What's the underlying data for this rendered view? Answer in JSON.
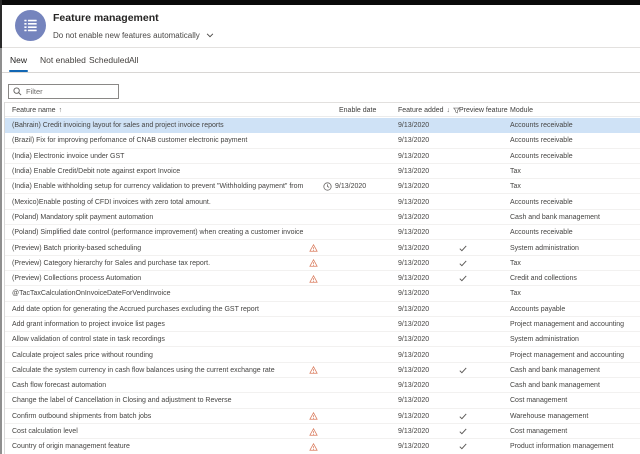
{
  "header": {
    "title": "Feature management",
    "subtitle": "Do not enable new features automatically",
    "icon": "feature-management-workspace-icon"
  },
  "tabs": [
    {
      "label": "New",
      "selected": true
    },
    {
      "label": "Not enabled",
      "selected": false
    },
    {
      "label": "Scheduled",
      "selected": false
    },
    {
      "label": "All",
      "selected": false
    }
  ],
  "filter": {
    "placeholder": "Filter",
    "icon": "search-icon"
  },
  "table": {
    "columns": [
      {
        "label": "Feature name",
        "sort": "asc"
      },
      {
        "label": "Enable date",
        "sort": null
      },
      {
        "label": "Feature added",
        "sort": "desc",
        "filtered": true
      },
      {
        "label": "Preview feature",
        "sort": null
      },
      {
        "label": "Module",
        "sort": null
      }
    ],
    "rows": [
      {
        "name": "(Bahrain) Credit invoicing layout for sales and project invoice reports",
        "warning": false,
        "enable_date": "",
        "feature_added": "9/13/2020",
        "preview": false,
        "module": "Accounts receivable",
        "selected": true
      },
      {
        "name": "(Brazil) Fix for improving perfomance of CNAB customer electronic payment",
        "warning": false,
        "enable_date": "",
        "feature_added": "9/13/2020",
        "preview": false,
        "module": "Accounts receivable",
        "selected": false
      },
      {
        "name": "(India) Electronic invoice under GST",
        "warning": false,
        "enable_date": "",
        "feature_added": "9/13/2020",
        "preview": false,
        "module": "Accounts receivable",
        "selected": false
      },
      {
        "name": "(India) Enable Credit/Debit note against export Invoice",
        "warning": false,
        "enable_date": "",
        "feature_added": "9/13/2020",
        "preview": false,
        "module": "Tax",
        "selected": false
      },
      {
        "name": "(India) Enable withholding setup for currency validation to prevent \"Withholding payment\" from f...",
        "warning": false,
        "enable_date": "9/13/2020",
        "feature_added": "9/13/2020",
        "preview": false,
        "module": "Tax",
        "selected": false
      },
      {
        "name": "(Mexico)Enable posting of CFDI invoices with zero total amount.",
        "warning": false,
        "enable_date": "",
        "feature_added": "9/13/2020",
        "preview": false,
        "module": "Accounts receivable",
        "selected": false
      },
      {
        "name": "(Poland) Mandatory split payment automation",
        "warning": false,
        "enable_date": "",
        "feature_added": "9/13/2020",
        "preview": false,
        "module": "Cash and bank management",
        "selected": false
      },
      {
        "name": "(Poland) Simplified date control (performance improvement) when creating a customer invoice.",
        "warning": false,
        "enable_date": "",
        "feature_added": "9/13/2020",
        "preview": false,
        "module": "Accounts receivable",
        "selected": false
      },
      {
        "name": "(Preview) Batch priority-based scheduling",
        "warning": true,
        "enable_date": "",
        "feature_added": "9/13/2020",
        "preview": true,
        "module": "System administration",
        "selected": false
      },
      {
        "name": "(Preview) Category hierarchy for Sales and purchase tax report.",
        "warning": true,
        "enable_date": "",
        "feature_added": "9/13/2020",
        "preview": true,
        "module": "Tax",
        "selected": false
      },
      {
        "name": "(Preview) Collections process Automation",
        "warning": true,
        "enable_date": "",
        "feature_added": "9/13/2020",
        "preview": true,
        "module": "Credit and collections",
        "selected": false
      },
      {
        "name": "@TacTaxCalculationOnInvoiceDateForVendInvoice",
        "warning": false,
        "enable_date": "",
        "feature_added": "9/13/2020",
        "preview": false,
        "module": "Tax",
        "selected": false
      },
      {
        "name": "Add date option for generating the Accrued purchases excluding the GST report",
        "warning": false,
        "enable_date": "",
        "feature_added": "9/13/2020",
        "preview": false,
        "module": "Accounts payable",
        "selected": false
      },
      {
        "name": "Add grant information to project invoice list pages",
        "warning": false,
        "enable_date": "",
        "feature_added": "9/13/2020",
        "preview": false,
        "module": "Project management and accounting",
        "selected": false
      },
      {
        "name": "Allow validation of control state in task recordings",
        "warning": false,
        "enable_date": "",
        "feature_added": "9/13/2020",
        "preview": false,
        "module": "System administration",
        "selected": false
      },
      {
        "name": "Calculate project sales price without rounding",
        "warning": false,
        "enable_date": "",
        "feature_added": "9/13/2020",
        "preview": false,
        "module": "Project management and accounting",
        "selected": false
      },
      {
        "name": "Calculate the system currency in cash flow balances using the current exchange rate",
        "warning": true,
        "enable_date": "",
        "feature_added": "9/13/2020",
        "preview": true,
        "module": "Cash and bank management",
        "selected": false
      },
      {
        "name": "Cash flow forecast automation",
        "warning": false,
        "enable_date": "",
        "feature_added": "9/13/2020",
        "preview": false,
        "module": "Cash and bank management",
        "selected": false
      },
      {
        "name": "Change the label of Cancellation in Closing and adjustment to Reverse",
        "warning": false,
        "enable_date": "",
        "feature_added": "9/13/2020",
        "preview": false,
        "module": "Cost management",
        "selected": false
      },
      {
        "name": "Confirm outbound shipments from batch jobs",
        "warning": true,
        "enable_date": "",
        "feature_added": "9/13/2020",
        "preview": true,
        "module": "Warehouse management",
        "selected": false
      },
      {
        "name": "Cost calculation level",
        "warning": true,
        "enable_date": "",
        "feature_added": "9/13/2020",
        "preview": true,
        "module": "Cost management",
        "selected": false
      },
      {
        "name": "Country of origin management feature",
        "warning": true,
        "enable_date": "",
        "feature_added": "9/13/2020",
        "preview": true,
        "module": "Product information management",
        "selected": false
      }
    ]
  },
  "colors": {
    "accent": "#1267b4",
    "selected_row": "#cfe2f6",
    "warning": "#d9795a",
    "workspace_icon_bg": "#7584bd",
    "top_bar": "#0a0a0a"
  }
}
